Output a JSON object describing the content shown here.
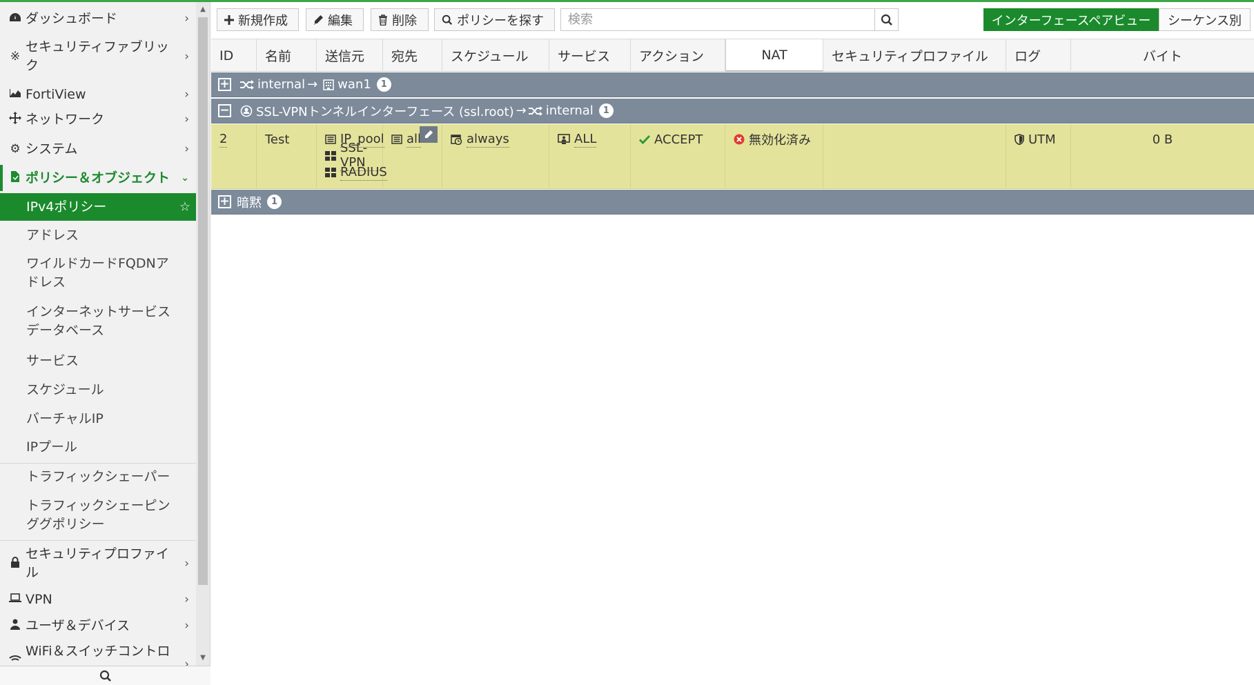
{
  "sidebar": {
    "items": [
      {
        "label": "ダッシュボード",
        "icon": "dashboard-icon"
      },
      {
        "label": "セキュリティファブリック",
        "icon": "fabric-icon"
      },
      {
        "label": "FortiView",
        "icon": "chart-icon"
      },
      {
        "label": "ネットワーク",
        "icon": "network-icon"
      },
      {
        "label": "システム",
        "icon": "gear-icon"
      },
      {
        "label": "ポリシー＆オブジェクト",
        "icon": "policy-icon"
      }
    ],
    "subitems": [
      "IPv4ポリシー",
      "アドレス",
      "ワイルドカードFQDNアドレス",
      "インターネットサービスデータベース",
      "サービス",
      "スケジュール",
      "バーチャルIP",
      "IPプール",
      "トラフィックシェーパー",
      "トラフィックシェーピンググポリシー"
    ],
    "items_after": [
      {
        "label": "セキュリティプロファイル",
        "icon": "lock-icon"
      },
      {
        "label": "VPN",
        "icon": "laptop-icon"
      },
      {
        "label": "ユーザ＆デバイス",
        "icon": "user-icon"
      },
      {
        "label": "WiFi＆スイッチコントロ",
        "icon": "wifi-icon"
      }
    ]
  },
  "toolbar": {
    "new_label": "新規作成",
    "edit_label": "編集",
    "delete_label": "削除",
    "find_label": "ポリシーを探す",
    "search_placeholder": "検索",
    "view_interface_pair": "インターフェースペアビュー",
    "view_sequence": "シーケンス別"
  },
  "table": {
    "columns": [
      "ID",
      "名前",
      "送信元",
      "宛先",
      "スケジュール",
      "サービス",
      "アクション",
      "NAT",
      "セキュリティプロファイル",
      "ログ",
      "バイト"
    ],
    "groups": [
      {
        "from": "internal",
        "arrow": "→",
        "to": "wan1",
        "count": "1"
      },
      {
        "from": "SSL-VPNトンネルインターフェース (ssl.root)",
        "arrow": "→",
        "to": "internal",
        "count": "1"
      },
      {
        "label": "暗黙",
        "count": "1"
      }
    ],
    "row": {
      "id": "2",
      "name": "Test",
      "source": [
        "IP_pool",
        "SSL-VPN",
        "RADIUS"
      ],
      "destination": "all",
      "schedule": "always",
      "service": "ALL",
      "action": "ACCEPT",
      "nat": "無効化済み",
      "security_profile": "",
      "log": "UTM",
      "bytes": "0 B"
    }
  },
  "colors": {
    "accent": "#1b8a2c",
    "group_header": "#7c8a9a",
    "row_highlight": "#e4e39b",
    "accept": "#2e9a3a",
    "disabled": "#e03a2e"
  }
}
